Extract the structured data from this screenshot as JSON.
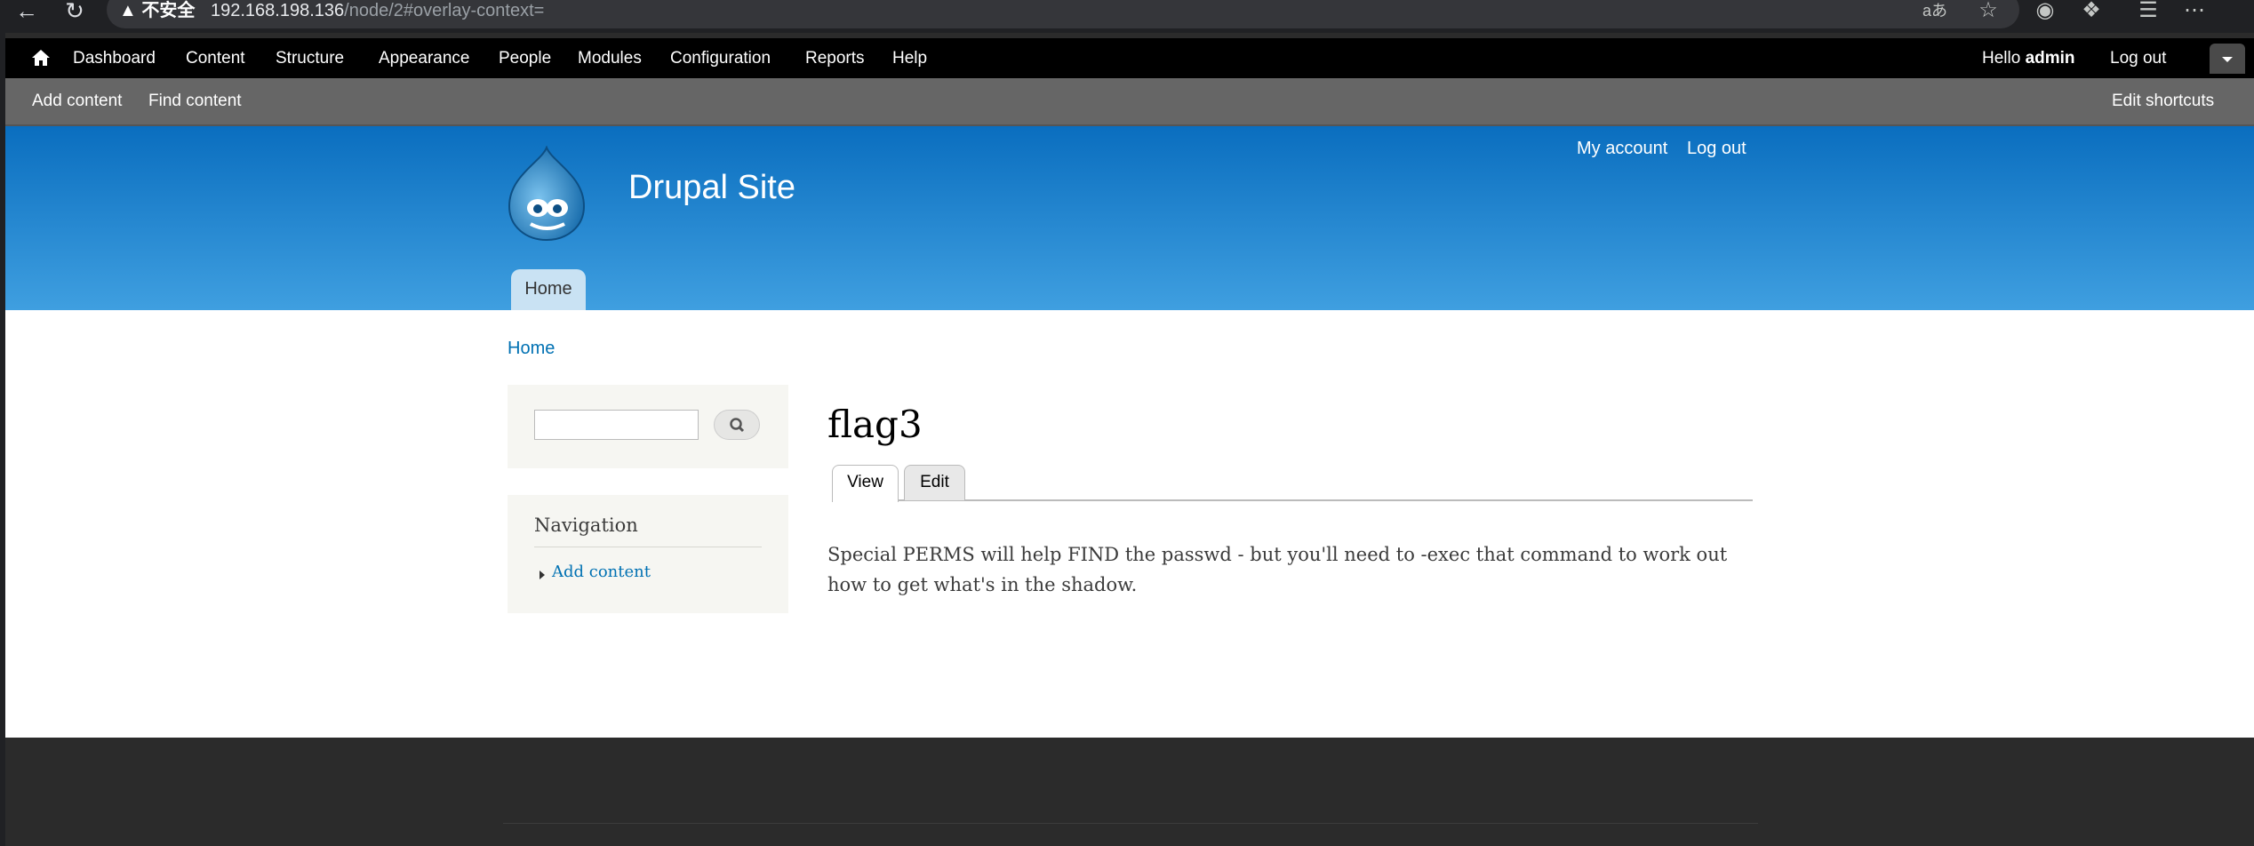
{
  "browser": {
    "security_warning": "不安全",
    "url_host": "192.168.198.136",
    "url_path": "/node/2#overlay-context=",
    "back_icon": "back-arrow-icon",
    "reload_icon": "reload-icon",
    "translate_icon_text": "aあ"
  },
  "toolbar": {
    "home_icon": "home-icon",
    "items": [
      "Dashboard",
      "Content",
      "Structure",
      "Appearance",
      "People",
      "Modules",
      "Configuration",
      "Reports",
      "Help"
    ],
    "hello_prefix": "Hello ",
    "username": "admin",
    "logout": "Log out"
  },
  "shortcuts": {
    "add_content": "Add content",
    "find_content": "Find content",
    "edit_shortcuts": "Edit shortcuts"
  },
  "header": {
    "site_name": "Drupal Site",
    "my_account": "My account",
    "log_out": "Log out",
    "main_menu_home": "Home"
  },
  "content": {
    "breadcrumb_home": "Home",
    "navigation_title": "Navigation",
    "navigation_link": "Add content",
    "node_title": "flag3",
    "tab_view": "View",
    "tab_edit": "Edit",
    "body": "Special PERMS will help FIND the passwd - but you'll need to -exec that command to work out how to get what's in the shadow."
  },
  "colors": {
    "toolbar_bg": "#000000",
    "shortcuts_bg": "#666666",
    "header_top": "#0a6ebf",
    "header_bottom": "#3f9fe0",
    "link": "#0071b3",
    "footer_bg": "#2b2b2b"
  }
}
